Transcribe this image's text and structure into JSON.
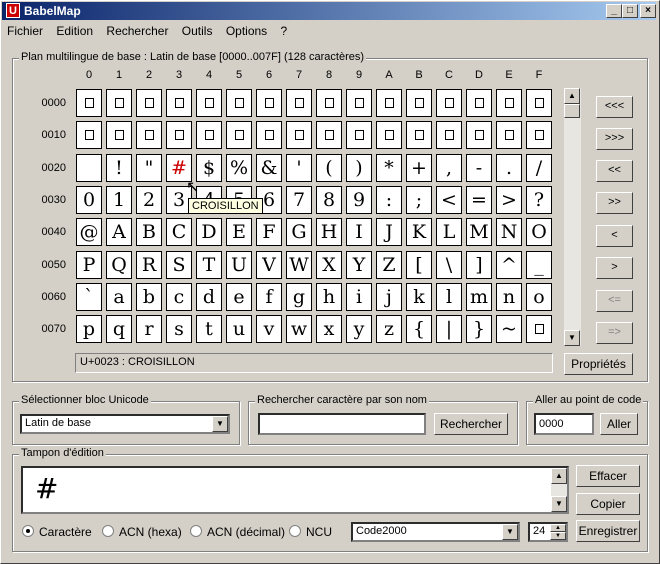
{
  "window": {
    "title": "BabelMap",
    "app_icon_glyph": "U"
  },
  "menu": [
    {
      "label": "Fichier"
    },
    {
      "label": "Edition"
    },
    {
      "label": "Rechercher"
    },
    {
      "label": "Outils"
    },
    {
      "label": "Options"
    },
    {
      "label": "?"
    }
  ],
  "grid": {
    "label": "Plan multilingue de base : Latin de base [0000..007F] (128 caractères)",
    "columns": [
      "0",
      "1",
      "2",
      "3",
      "4",
      "5",
      "6",
      "7",
      "8",
      "9",
      "A",
      "B",
      "C",
      "D",
      "E",
      "F"
    ],
    "rows": [
      {
        "label": "0000",
        "chars": [
          "",
          "",
          "",
          "",
          "",
          "",
          "",
          "",
          "",
          "",
          "",
          "",
          "",
          "",
          "",
          ""
        ]
      },
      {
        "label": "0010",
        "chars": [
          "",
          "",
          "",
          "",
          "",
          "",
          "",
          "",
          "",
          "",
          "",
          "",
          "",
          "",
          "",
          ""
        ]
      },
      {
        "label": "0020",
        "chars": [
          " ",
          "!",
          "\"",
          "#",
          "$",
          "%",
          "&",
          "'",
          "(",
          ")",
          "*",
          "+",
          ",",
          "-",
          ".",
          "/"
        ]
      },
      {
        "label": "0030",
        "chars": [
          "0",
          "1",
          "2",
          "3",
          "4",
          "5",
          "6",
          "7",
          "8",
          "9",
          ":",
          ";",
          "<",
          "=",
          ">",
          "?"
        ]
      },
      {
        "label": "0040",
        "chars": [
          "@",
          "A",
          "B",
          "C",
          "D",
          "E",
          "F",
          "G",
          "H",
          "I",
          "J",
          "K",
          "L",
          "M",
          "N",
          "O"
        ]
      },
      {
        "label": "0050",
        "chars": [
          "P",
          "Q",
          "R",
          "S",
          "T",
          "U",
          "V",
          "W",
          "X",
          "Y",
          "Z",
          "[",
          "\\",
          "]",
          "^",
          "_"
        ]
      },
      {
        "label": "0060",
        "chars": [
          "`",
          "a",
          "b",
          "c",
          "d",
          "e",
          "f",
          "g",
          "h",
          "i",
          "j",
          "k",
          "l",
          "m",
          "n",
          "o"
        ]
      },
      {
        "label": "0070",
        "chars": [
          "p",
          "q",
          "r",
          "s",
          "t",
          "u",
          "v",
          "w",
          "x",
          "y",
          "z",
          "{",
          "|",
          "}",
          "~",
          ""
        ]
      }
    ],
    "selected": {
      "row": 2,
      "col": 3
    },
    "tooltip": "CROISILLON",
    "status": "U+0023 : CROISILLON"
  },
  "nav_buttons": [
    "<<<",
    ">>>",
    "<<",
    ">>",
    "<",
    ">",
    "<=",
    "=>"
  ],
  "properties_button": "Propriétés",
  "block_group": {
    "label": "Sélectionner bloc Unicode",
    "value": "Latin de base"
  },
  "search_group": {
    "label": "Rechercher caractère par son nom",
    "value": "",
    "button": "Rechercher"
  },
  "goto_group": {
    "label": "Aller au point de code",
    "value": "0000",
    "button": "Aller"
  },
  "edit_group": {
    "label": "Tampon d'édition",
    "buffer": "#"
  },
  "edit_buttons": {
    "clear": "Effacer",
    "copy": "Copier",
    "save": "Enregistrer"
  },
  "radio_options": [
    {
      "label": "Caractère",
      "checked": true
    },
    {
      "label": "ACN (hexa)",
      "checked": false
    },
    {
      "label": "ACN (décimal)",
      "checked": false
    },
    {
      "label": "NCU",
      "checked": false
    }
  ],
  "font_select": {
    "value": "Code2000"
  },
  "font_size": {
    "value": "24"
  }
}
